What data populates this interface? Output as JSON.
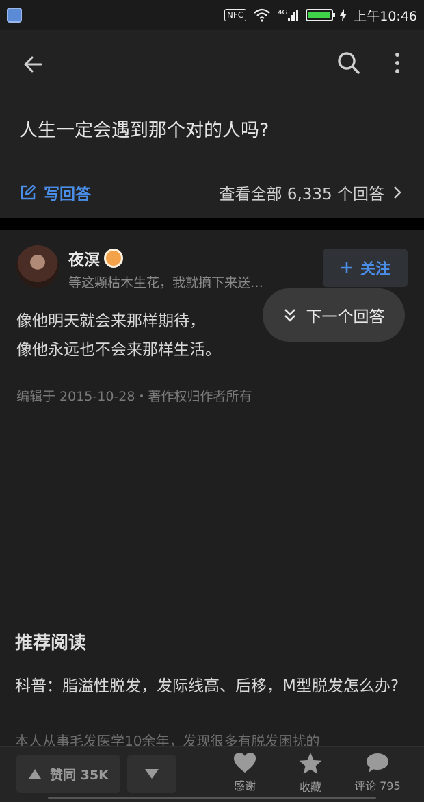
{
  "status_bar": {
    "nfc": "NFC",
    "signal": "4G",
    "time": "上午10:46",
    "battery_level": 0.95
  },
  "question": {
    "title": "人生一定会遇到那个对的人吗?",
    "write_answer": "写回答",
    "view_all": "查看全部 6,335 个回答"
  },
  "author": {
    "name": "夜溟",
    "bio": "等这颗枯木生花，我就摘下来送…",
    "follow_label": "关注"
  },
  "next_answer_label": "下一个回答",
  "answer": {
    "lines": [
      "像他明天就会来那样期待，",
      "像他永远也不会来那样生活。"
    ],
    "meta": "编辑于 2015-10-28・著作权归作者所有"
  },
  "recommended": {
    "title": "推荐阅读",
    "item_title": "科普：脂溢性脱发，发际线高、后移，M型脱发怎么办?",
    "item_snippet": "本人从事毛发医学10余年，发现很多有脱发困扰的"
  },
  "bottom_bar": {
    "agree_label": "赞同 35K",
    "thanks_label": "感谢",
    "collect_label": "收藏",
    "comment_label": "评论 795"
  }
}
